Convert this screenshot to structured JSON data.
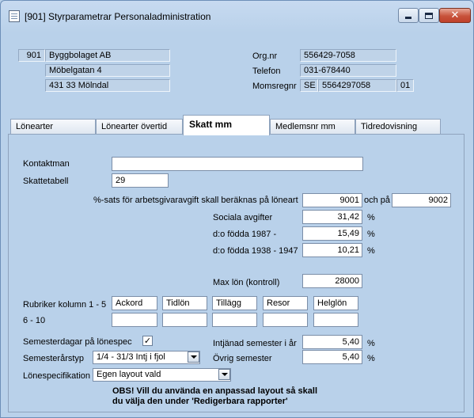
{
  "window": {
    "title": "[901]  Styrparametrar Personaladministration"
  },
  "company": {
    "number": "901",
    "name": "Byggbolaget AB",
    "street": "Möbelgatan 4",
    "postal": "431 33  Mölndal",
    "orgnr_label": "Org.nr",
    "orgnr": "556429-7058",
    "phone_label": "Telefon",
    "phone": "031-678440",
    "vat_label": "Momsregnr",
    "vat_country": "SE",
    "vat_number": "5564297058",
    "vat_suffix": "01"
  },
  "tabs": [
    {
      "label": "Lönearter"
    },
    {
      "label": "Lönearter övertid"
    },
    {
      "label": "Skatt mm"
    },
    {
      "label": "Medlemsnr mm"
    },
    {
      "label": "Tidredovisning"
    }
  ],
  "active_tab": "Skatt mm",
  "form": {
    "contact_label": "Kontaktman",
    "contact_value": "",
    "tax_table_label": "Skattetabell",
    "tax_table_value": "29",
    "percent_label": "%-sats för arbetsgivaravgift skall beräknas på löneart",
    "percent_wage_type": "9001",
    "and_on_label": "och på",
    "percent_wage_type2": "9002",
    "social_label": "Sociala avgifter",
    "social_value": "31,42",
    "born1987_label": "d:o födda 1987 -",
    "born1987_value": "15,49",
    "born1938_label": "d:o födda 1938 - 1947",
    "born1938_value": "10,21",
    "pct_sign": "%",
    "maxpay_label": "Max lön (kontroll)",
    "maxpay_value": "28000",
    "rubrics_label": "Rubriker kolumn 1 - 5",
    "rubrics_row1": [
      "Ackord",
      "Tidlön",
      "Tillägg",
      "Resor",
      "Helglön"
    ],
    "rubrics_row2_label": "6 - 10",
    "rubrics_row2": [
      "",
      "",
      "",
      "",
      ""
    ],
    "vacation_days_label": "Semesterdagar på lönespec",
    "vacation_days_checked": true,
    "vacation_days_check_glyph": "✓",
    "vacation_year_label": "Semesterårstyp",
    "vacation_year_value": "1/4 - 31/3  Intj i fjol",
    "earned_label": "Intjänad semester i år",
    "earned_value": "5,40",
    "other_label": "Övrig semester",
    "other_value": "5,40",
    "payslip_label": "Lönespecifikation",
    "payslip_value": "Egen layout vald",
    "notice_line1": "OBS! Vill du använda en anpassad layout så skall",
    "notice_line2": "du välja den under 'Redigerbara rapporter'"
  },
  "icons": {
    "app": "form-icon",
    "minimize": "minimize-icon",
    "maximize": "maximize-icon",
    "close": "close-icon",
    "close_glyph": "✕"
  }
}
